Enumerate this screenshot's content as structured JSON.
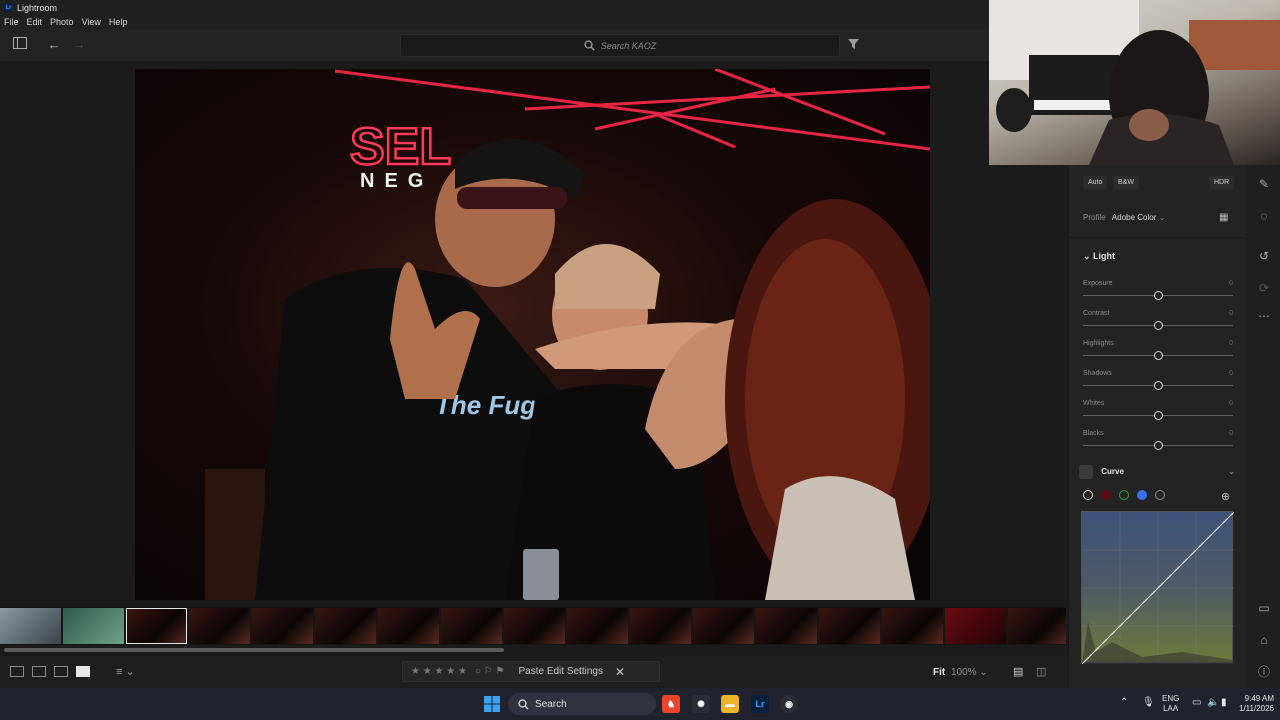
{
  "window": {
    "title": "Lightroom",
    "badge": "Lr"
  },
  "menu": [
    "File",
    "Edit",
    "Photo",
    "View",
    "Help"
  ],
  "toolbar": {
    "search_placeholder": "Search KAOZ"
  },
  "bottombar": {
    "paste_label": "Paste Edit Settings",
    "close_label": "✕",
    "stars": "★ ★ ★ ★ ★",
    "fit_label": "Fit",
    "zoom_label": "100%"
  },
  "panel": {
    "chips": {
      "auto": "Auto",
      "bw": "B&W",
      "hdr": "HDR"
    },
    "profile_label": "Profile",
    "profile_value": "Adobe Color",
    "light_label": "Light",
    "sliders": [
      {
        "label": "Exposure",
        "value": "0"
      },
      {
        "label": "Contrast",
        "value": "0"
      },
      {
        "label": "Highlights",
        "value": "0"
      },
      {
        "label": "Shadows",
        "value": "0"
      },
      {
        "label": "Whites",
        "value": "0"
      },
      {
        "label": "Blacks",
        "value": "0"
      }
    ],
    "curve_label": "Curve"
  },
  "taskbar": {
    "search_label": "Search",
    "lang_top": "ENG",
    "lang_bottom": "LAA",
    "time": "9:49 AM",
    "date": "1/11/2026"
  },
  "photo": {
    "sign_text": "NEG",
    "shirt_text": "The Fugee"
  },
  "colors": {
    "accent": "#34a4ff",
    "neon": "#ff2a4a"
  }
}
